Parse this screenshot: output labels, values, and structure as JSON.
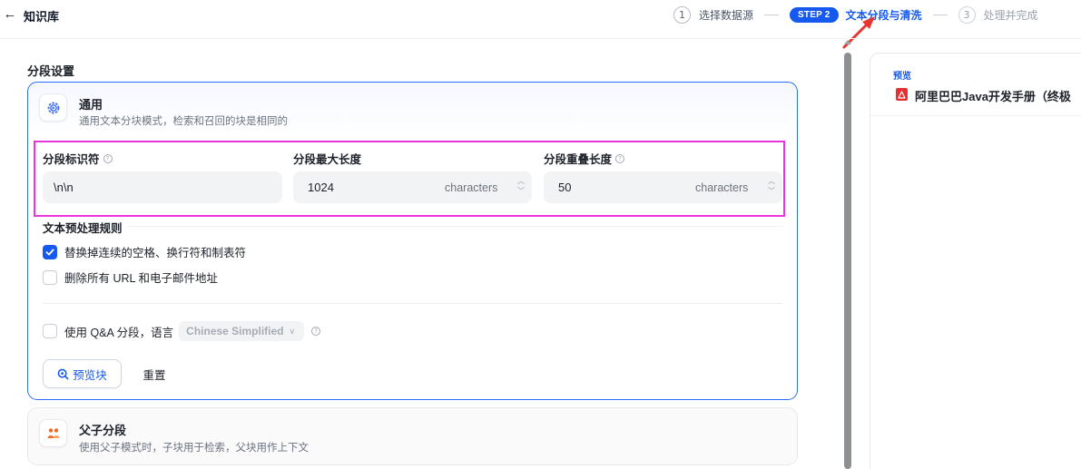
{
  "header": {
    "back_icon": "arrow-left-icon",
    "title": "知识库"
  },
  "steps": [
    {
      "num": "1",
      "label": "选择数据源"
    },
    {
      "pill": "STEP 2",
      "label": "文本分段与清洗"
    },
    {
      "num": "3",
      "label": "处理并完成"
    }
  ],
  "section_title": "分段设置",
  "general": {
    "title": "通用",
    "desc": "通用文本分块模式，检索和召回的块是相同的",
    "icon": "gear-icon"
  },
  "fields": {
    "separator": {
      "label": "分段标识符",
      "value": "\\n\\n"
    },
    "max_length": {
      "label": "分段最大长度",
      "value": "1024",
      "unit": "characters"
    },
    "overlap": {
      "label": "分段重叠长度",
      "value": "50",
      "unit": "characters"
    }
  },
  "rules": {
    "title": "文本预处理规则",
    "items": [
      {
        "label": "替换掉连续的空格、换行符和制表符",
        "checked": true
      },
      {
        "label": "删除所有 URL 和电子邮件地址",
        "checked": false
      }
    ]
  },
  "qa": {
    "label": "使用 Q&A 分段，语言",
    "language": "Chinese Simplified",
    "checked": false
  },
  "buttons": {
    "preview": "预览块",
    "reset": "重置"
  },
  "parent_child": {
    "title": "父子分段",
    "desc": "使用父子模式时，子块用于检索，父块用作上下文",
    "icon": "parent-child-icon"
  },
  "preview": {
    "tag": "预览",
    "file": "阿里巴巴Java开发手册（终极"
  },
  "colors": {
    "accent": "#1559ee",
    "highlight_annotation": "#e834e1",
    "arrow_annotation": "#e8352f",
    "pdf": "#e33030"
  }
}
